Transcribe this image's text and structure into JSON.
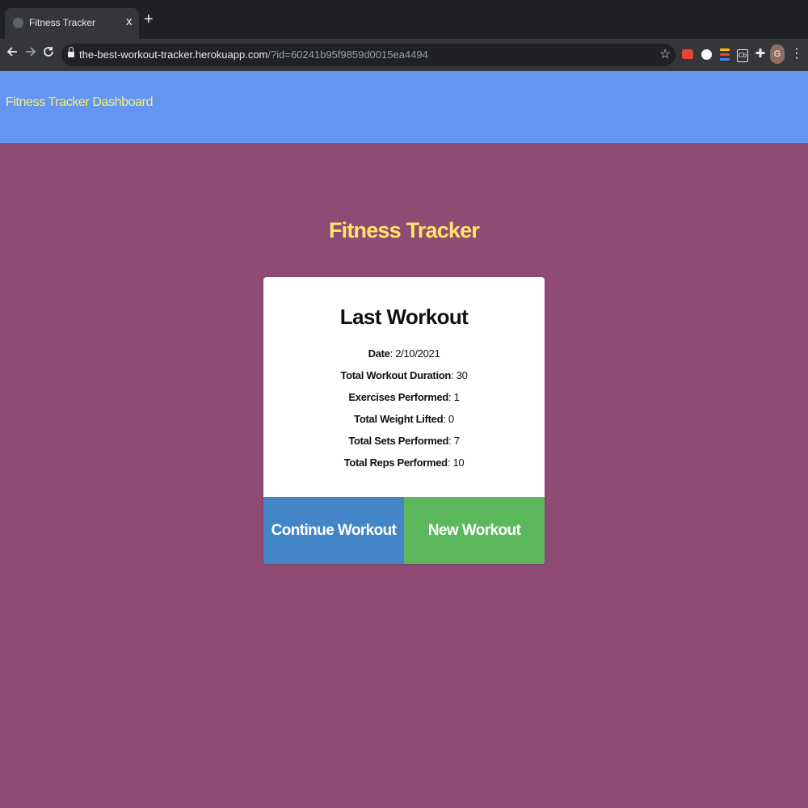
{
  "browser": {
    "tab_title": "Fitness Tracker",
    "tab_close": "x",
    "new_tab": "+",
    "url_host": "the-best-workout-tracker.herokuapp.com",
    "url_path": "/?id=60241b95f9859d0015ea4494",
    "avatar_initial": "G"
  },
  "navbar": {
    "brand": "Fitness Tracker Dashboard",
    "background": "#6495f2",
    "brand_color": "#f5f16b"
  },
  "page": {
    "heading": "Fitness Tracker",
    "background": "#8e4b74",
    "heading_color": "#ffe66b"
  },
  "card": {
    "title": "Last Workout",
    "stats": [
      {
        "label": "Date",
        "value": "2/10/2021"
      },
      {
        "label": "Total Workout Duration",
        "value": "30"
      },
      {
        "label": "Exercises Performed",
        "value": "1"
      },
      {
        "label": "Total Weight Lifted",
        "value": "0"
      },
      {
        "label": "Total Sets Performed",
        "value": "7"
      },
      {
        "label": "Total Reps Performed",
        "value": "10"
      }
    ],
    "continue_label": "Continue Workout",
    "new_label": "New Workout",
    "continue_color": "#4286c8",
    "new_color": "#5cb85c"
  },
  "icons": {
    "back": "arrow-left-icon",
    "forward": "arrow-right-icon",
    "reload": "reload-icon",
    "lock": "lock-icon",
    "star": "star-icon",
    "extensions": "puzzle-icon",
    "menu": "kebab-menu-icon"
  }
}
